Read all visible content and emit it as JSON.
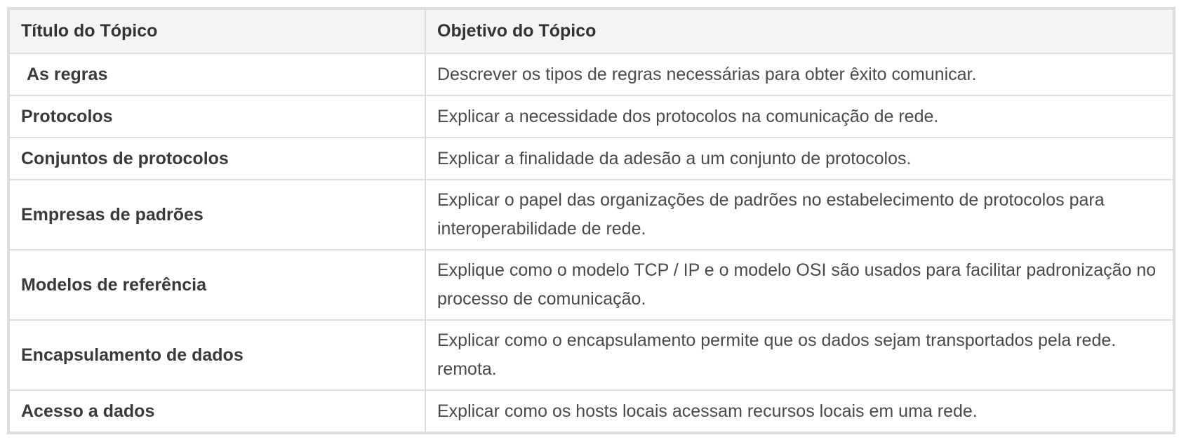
{
  "table": {
    "headers": [
      "Título do Tópico",
      "Objetivo do Tópico"
    ],
    "rows": [
      {
        "title": "As regras",
        "objective": "Descrever os tipos de regras necessárias para obter êxito comunicar."
      },
      {
        "title": "Protocolos",
        "objective": "Explicar a necessidade dos protocolos na comunicação de rede."
      },
      {
        "title": "Conjuntos de protocolos",
        "objective": "Explicar a finalidade da adesão a um conjunto de protocolos."
      },
      {
        "title": "Empresas de padrões",
        "objective": "Explicar o papel das organizações de padrões no estabelecimento de protocolos para interoperabilidade de rede."
      },
      {
        "title": "Modelos de referência",
        "objective": "Explique como o modelo TCP / IP e o modelo OSI são usados para facilitar padronização no processo de comunicação."
      },
      {
        "title": "Encapsulamento de dados",
        "objective": "Explicar como o encapsulamento permite que os dados sejam transportados pela rede. remota."
      },
      {
        "title": "Acesso a dados",
        "objective": "Explicar como os hosts locais acessam recursos locais em uma rede."
      }
    ]
  }
}
